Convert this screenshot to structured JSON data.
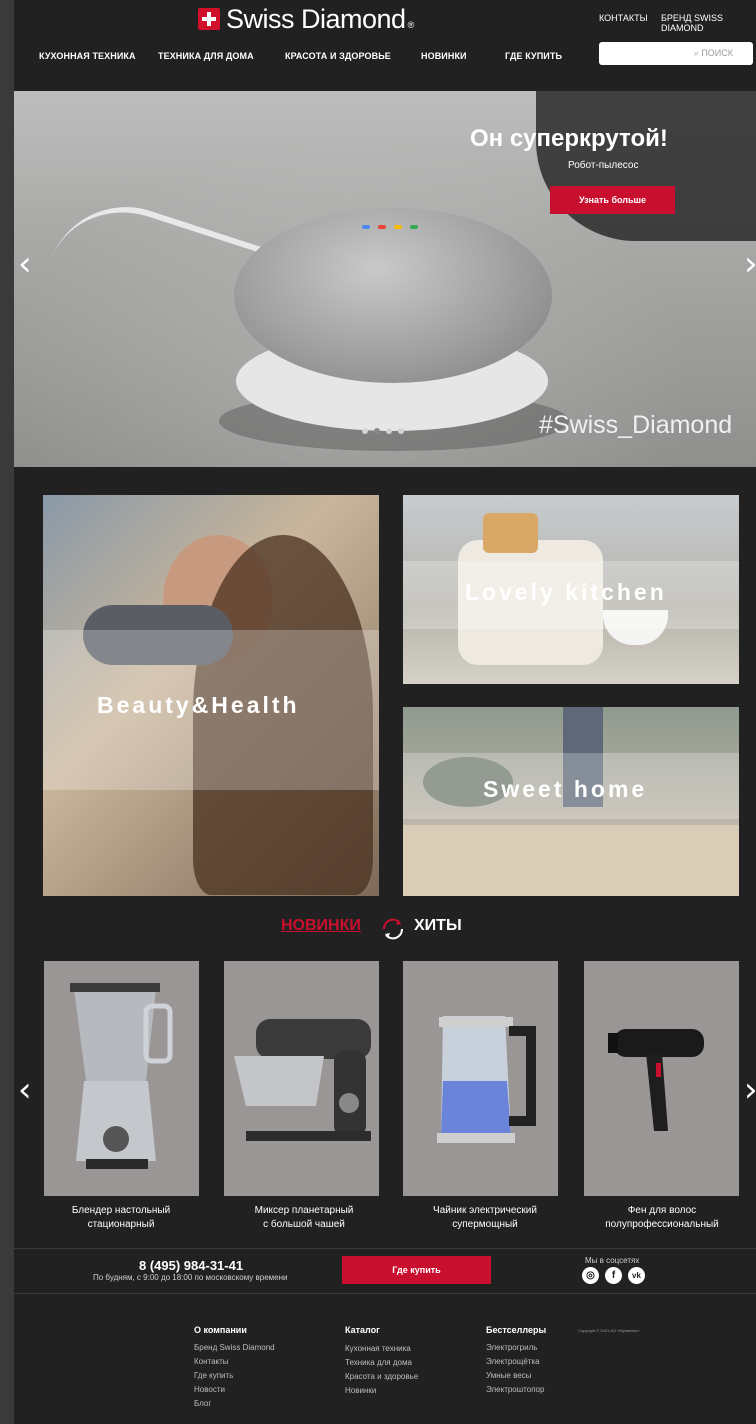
{
  "brand": {
    "name": "Swiss Diamond",
    "reg": "®"
  },
  "top_links": [
    "КОНТАКТЫ",
    "БРЕНД SWISS DIAMOND"
  ],
  "nav": [
    "КУХОННАЯ ТЕХНИКА",
    "ТЕХНИКА ДЛЯ ДОМА",
    "КРАСОТА И ЗДОРОВЬЕ",
    "НОВИНКИ",
    "ГДЕ КУПИТЬ"
  ],
  "search": {
    "placeholder": "ПОИСК"
  },
  "hero": {
    "title": "Он суперкрутой!",
    "subtitle": "Робот-пылесос",
    "button": "Узнать больше",
    "hashtag": "#Swiss_Diamond",
    "slides_total": 4,
    "active_slide": 2
  },
  "categories": [
    "Beauty&Health",
    "Lovely kitchen",
    "Sweet home"
  ],
  "tabs": {
    "new": "НОВИНКИ",
    "hits": "ХИТЫ"
  },
  "products": [
    {
      "name_line1": "Блендер настольный",
      "name_line2": "стационарный"
    },
    {
      "name_line1": "Миксер планетарный",
      "name_line2": "с большой чашей"
    },
    {
      "name_line1": "Чайник электрический",
      "name_line2": "супермощный"
    },
    {
      "name_line1": "Фен для волос",
      "name_line2": "полупрофессиональный"
    }
  ],
  "contact": {
    "phone": "8 (495) 984-31-41",
    "hours": "По будням, с 9:00 до 18:00 по московскому времени",
    "buy_button": "Где купить",
    "social_label": "Мы в соцсетях"
  },
  "footer": {
    "about": {
      "title": "О компании",
      "links": [
        "Бренд Swiss Diamond",
        "Контакты",
        "Где купить",
        "Новости",
        "Блог"
      ]
    },
    "catalog": {
      "title": "Каталог",
      "links": [
        "Кухонная техника",
        "Техника для дома",
        "Красота и здоровье",
        "Новинки"
      ]
    },
    "best": {
      "title": "Бестселлеры",
      "links": [
        "Электрогриль",
        "Электрощётка",
        "Умные весы",
        "Электроштопор"
      ]
    },
    "copyright": "Copyright © 2021 АО «Мулинекс»"
  },
  "colors": {
    "accent": "#c8102e",
    "background": "#212121"
  }
}
